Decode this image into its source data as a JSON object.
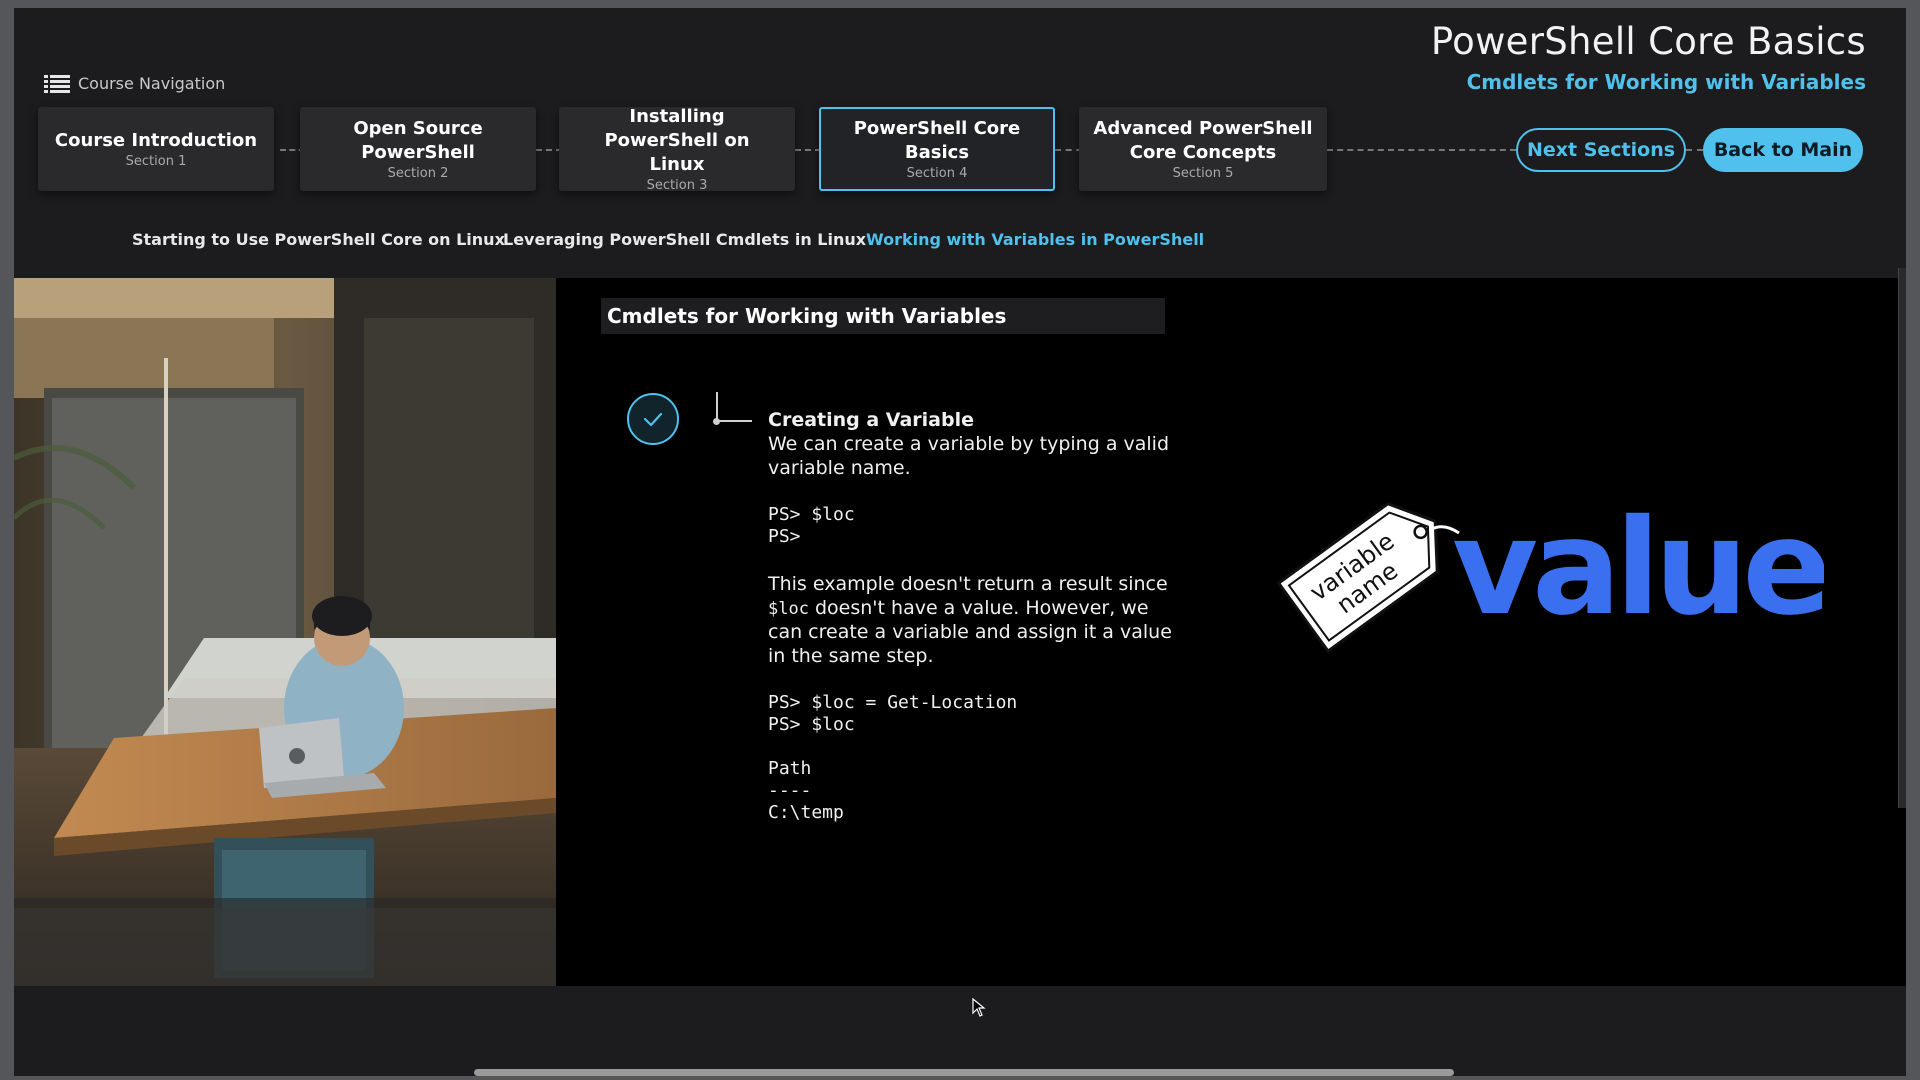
{
  "header": {
    "nav_label": "Course Navigation",
    "title": "PowerShell Core Basics",
    "subtitle": "Cmdlets for Working with Variables"
  },
  "sections": [
    {
      "title": "Course Introduction",
      "number": "Section 1"
    },
    {
      "title": "Open Source PowerShell",
      "number": "Section 2"
    },
    {
      "title": "Installing PowerShell on Linux",
      "number": "Section 3"
    },
    {
      "title": "PowerShell Core Basics",
      "number": "Section 4",
      "active": true
    },
    {
      "title": "Advanced PowerShell Core Concepts",
      "number": "Section 5"
    }
  ],
  "buttons": {
    "next_sections": "Next Sections",
    "back_to_main": "Back to Main"
  },
  "subtabs": [
    {
      "label": "Starting to Use PowerShell Core on Linux"
    },
    {
      "label": "Leveraging PowerShell Cmdlets in Linux"
    },
    {
      "label": "Working with Variables in PowerShell",
      "active": true
    }
  ],
  "content": {
    "card_title": "Cmdlets for Working with Variables",
    "heading": "Creating a Variable",
    "intro": "We can create a variable by typing a valid variable name.",
    "code1_line1": "PS> $loc",
    "code1_line2": "PS>",
    "para_before": "This example doesn't return a result since ",
    "para_code": "$loc",
    "para_after": " doesn't have a value. However, we can create a variable and assign it a value in the same step.",
    "code2_line1": "PS> $loc = Get-Location",
    "code2_line2": "PS> $loc",
    "out_header": "Path",
    "out_sep": "----",
    "out_value": "C:\\temp"
  },
  "illustration": {
    "tag_line1": "variable",
    "tag_line2": "name",
    "word": "value",
    "word_color": "#3a6ff0"
  },
  "colors": {
    "accent": "#4fc1ec",
    "panel": "#2a2a2c",
    "background": "#1c1c1e"
  }
}
